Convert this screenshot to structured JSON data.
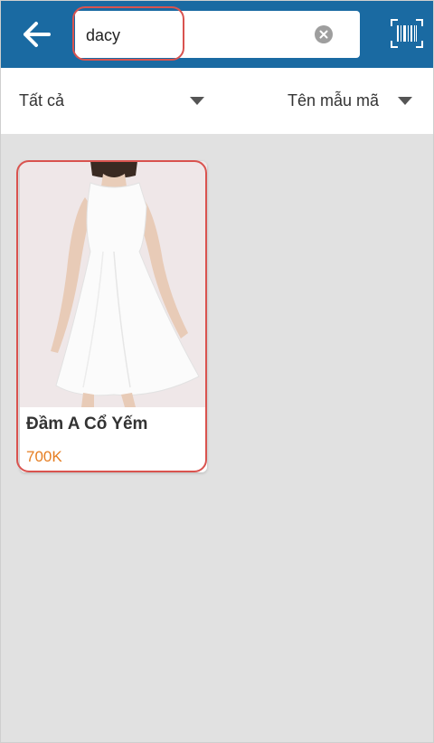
{
  "search": {
    "value": "dacy"
  },
  "filters": {
    "category_label": "Tất cả",
    "sort_label": "Tên mẫu mã"
  },
  "products": [
    {
      "name": "Đầm A Cổ Yếm",
      "price": "700K"
    }
  ],
  "colors": {
    "header": "#1a6aa2",
    "price": "#e67e22",
    "highlight": "#d9534f",
    "background": "#e1e1e1"
  },
  "icons": {
    "back": "arrow-left-icon",
    "clear": "clear-icon",
    "barcode": "barcode-scan-icon"
  }
}
